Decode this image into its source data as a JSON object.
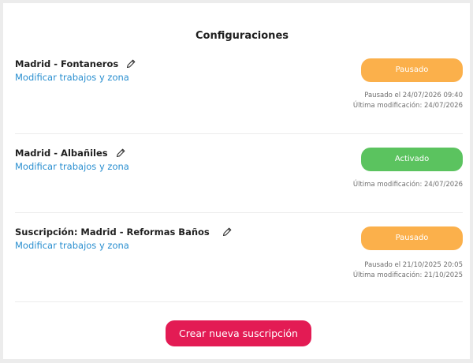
{
  "page": {
    "title": "Configuraciones"
  },
  "subscriptions": [
    {
      "name": "Madrid - Fontaneros",
      "edit_icon": "pencil-icon",
      "link_label": "Modificar trabajos y zona",
      "status_label": "Pausado",
      "status": "paused",
      "paused_text": "Pausado el 24/07/2026 09:40",
      "modified_text": "Última modificación: 24/07/2026"
    },
    {
      "name": "Madrid - Albañiles",
      "edit_icon": "pencil-icon",
      "link_label": "Modificar trabajos y zona",
      "status_label": "Activado",
      "status": "active",
      "modified_text": "Última modificación: 24/07/2026"
    },
    {
      "name": "Suscripción: Madrid - Reformas Baños",
      "edit_icon": "pencil-icon",
      "link_label": "Modificar trabajos y zona",
      "status_label": "Pausado",
      "status": "paused",
      "paused_text": "Pausado el 21/10/2025 20:05",
      "modified_text": "Última modificación: 21/10/2025"
    }
  ],
  "actions": {
    "create_label": "Crear nueva suscripción"
  },
  "colors": {
    "paused": "#fbb04b",
    "active": "#5bc35f",
    "link": "#2a8fd0",
    "primary_button": "#e31b54"
  }
}
